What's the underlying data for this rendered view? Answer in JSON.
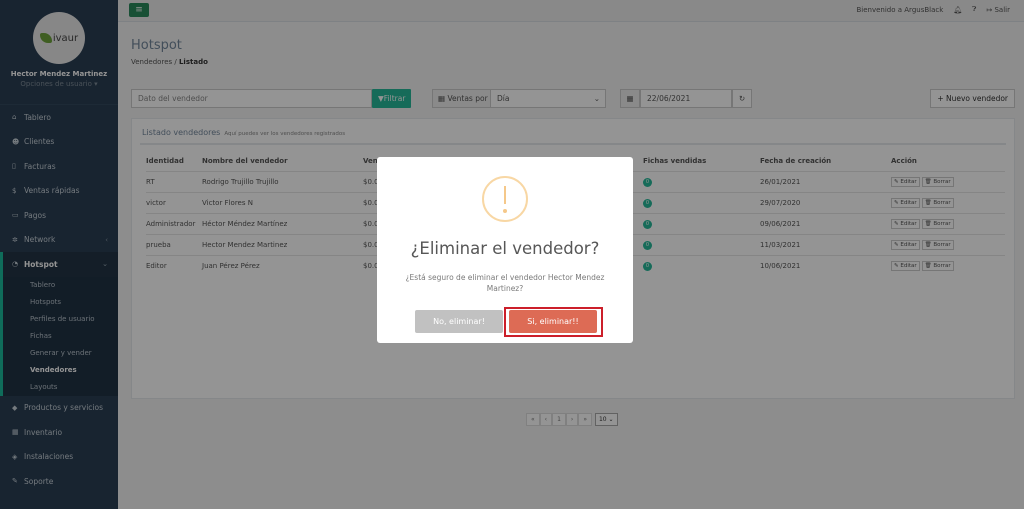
{
  "sidebar": {
    "brand": "ivaur",
    "user_name": "Hector Mendez Martinez",
    "user_options": "Opciones de usuario ▾",
    "items": [
      {
        "label": "Tablero",
        "icon": "home-icon"
      },
      {
        "label": "Clientes",
        "icon": "users-icon"
      },
      {
        "label": "Facturas",
        "icon": "file-icon"
      },
      {
        "label": "Ventas rápidas",
        "icon": "dollar-icon"
      },
      {
        "label": "Pagos",
        "icon": "card-icon"
      },
      {
        "label": "Network",
        "icon": "network-icon"
      },
      {
        "label": "Hotspot",
        "icon": "wifi-icon"
      },
      {
        "label": "Productos y servicios",
        "icon": "tag-icon"
      },
      {
        "label": "Inventario",
        "icon": "cubes-icon"
      },
      {
        "label": "Instalaciones",
        "icon": "wrench-icon"
      },
      {
        "label": "Soporte",
        "icon": "support-icon"
      }
    ],
    "hotspot_sub": [
      "Tablero",
      "Hotspots",
      "Perfiles de usuario",
      "Fichas",
      "Generar y vender",
      "Vendedores",
      "Layouts"
    ],
    "active_sub": "Vendedores"
  },
  "topbar": {
    "welcome": "Bienvenido a ArgusBlack",
    "logout": "Salir"
  },
  "page": {
    "title": "Hotspot",
    "crumb_parent": "Vendedores",
    "crumb_current": "Listado"
  },
  "filters": {
    "search_placeholder": "Dato del vendedor",
    "filter_button": "Filtrar",
    "sales_label": "Ventas por",
    "sales_value": "Día",
    "date_value": "22/06/2021",
    "new_button": "+ Nuevo vendedor"
  },
  "panel": {
    "title": "Listado vendedores",
    "subtitle": "Aquí puedes ver los vendedores registrados"
  },
  "table": {
    "headers": [
      "Identidad",
      "Nombre del vendedor",
      "Ven",
      "Fichas vendidas",
      "Fecha de creación",
      "Acción"
    ],
    "rows": [
      {
        "identity": "RT",
        "name": "Rodrigo Trujillo Trujillo",
        "sales": "$0.0",
        "tickets": "0",
        "created": "26/01/2021"
      },
      {
        "identity": "victor",
        "name": "Victor Flores N",
        "sales": "$0.0",
        "tickets": "0",
        "created": "29/07/2020"
      },
      {
        "identity": "Administrador",
        "name": "Héctor Méndez Martínez",
        "sales": "$0.0",
        "tickets": "0",
        "created": "09/06/2021"
      },
      {
        "identity": "prueba",
        "name": "Hector Mendez Martinez",
        "sales": "$0.0",
        "tickets": "0",
        "created": "11/03/2021"
      },
      {
        "identity": "Editor",
        "name": "Juan Pérez Pérez",
        "sales": "$0.0",
        "tickets": "0",
        "created": "10/06/2021"
      }
    ],
    "edit_label": "Editar",
    "delete_label": "Borrar"
  },
  "pagination": {
    "first": "«",
    "prev": "‹",
    "page": "1",
    "next": "›",
    "last": "»",
    "per_page": "10"
  },
  "modal": {
    "title": "¿Eliminar el vendedor?",
    "text": "¿Está seguro de eliminar el vendedor Hector Mendez Martinez?",
    "cancel": "No, eliminar!",
    "confirm": "Si, eliminar!!"
  }
}
